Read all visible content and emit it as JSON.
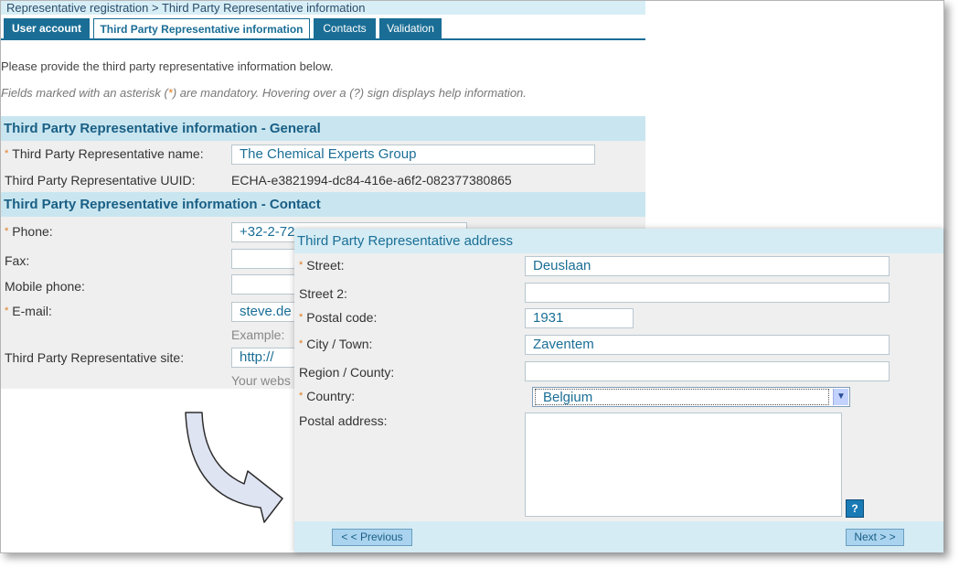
{
  "breadcrumb": "Representative registration > Third Party Representative information",
  "tabs": [
    {
      "label": "User account",
      "active": false
    },
    {
      "label": "Third Party Representative information",
      "active": true
    },
    {
      "label": "Contacts",
      "active": false
    },
    {
      "label": "Validation",
      "active": false
    }
  ],
  "intro": "Please provide the third party representative information below.",
  "hint": {
    "before": "Fields marked with an asterisk (",
    "star": "*",
    "after": ") are mandatory. Hovering over a (?) sign displays help information."
  },
  "general": {
    "title": "Third Party Representative information - General",
    "name_label": "Third Party Representative name:",
    "name_value": "The Chemical Experts Group",
    "uuid_label": "Third Party Representative UUID:",
    "uuid_value": "ECHA-e3821994-dc84-416e-a6f2-082377380865"
  },
  "contact": {
    "title": "Third Party Representative information - Contact",
    "phone_label": "Phone:",
    "phone_value": "+32-2-72",
    "fax_label": "Fax:",
    "mobile_label": "Mobile phone:",
    "email_label": "E-mail:",
    "email_value": "steve.de",
    "email_example": "Example:",
    "site_label": "Third Party Representative site:",
    "site_value": "http://",
    "site_hint": "Your webs"
  },
  "address": {
    "title": "Third Party Representative address",
    "street_label": "Street:",
    "street_value": "Deuslaan",
    "street2_label": "Street 2:",
    "postal_label": "Postal code:",
    "postal_value": "1931",
    "city_label": "City / Town:",
    "city_value": "Zaventem",
    "region_label": "Region / County:",
    "country_label": "Country:",
    "country_value": "Belgium",
    "postal_address_label": "Postal address:",
    "help_label": "?"
  },
  "nav": {
    "previous": "< < Previous",
    "next": "Next > >"
  },
  "colors": {
    "accent": "#1a6e96",
    "section_bg": "#c9e6f0",
    "mandatory_star": "#e07b20"
  }
}
